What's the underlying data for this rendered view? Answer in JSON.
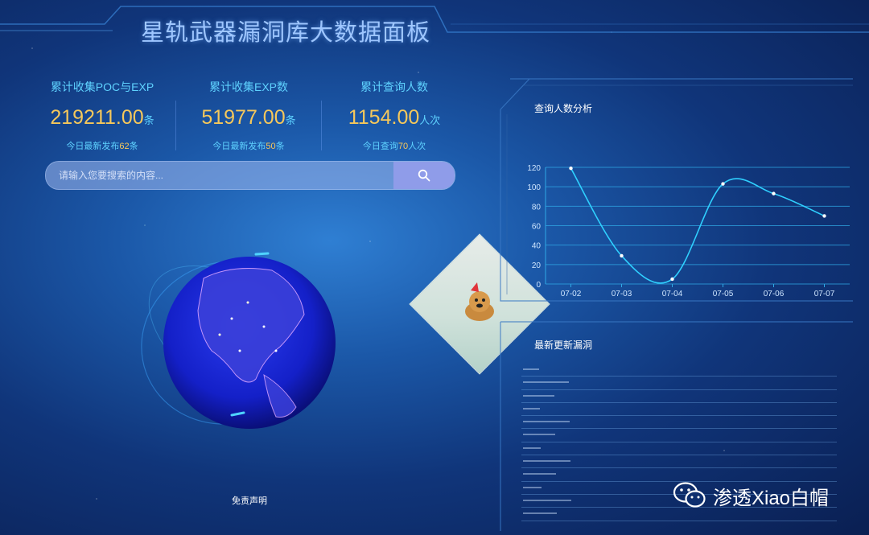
{
  "header": {
    "title": "星轨武器漏洞库大数据面板"
  },
  "stats": [
    {
      "label": "累计收集POC与EXP",
      "value": "219211.00",
      "unit": "条",
      "today_prefix": "今日最新发布",
      "today_num": "62",
      "today_suffix": "条"
    },
    {
      "label": "累计收集EXP数",
      "value": "51977.00",
      "unit": "条",
      "today_prefix": "今日最新发布",
      "today_num": "50",
      "today_suffix": "条"
    },
    {
      "label": "累计查询人数",
      "value": "1154.00",
      "unit": "人次",
      "today_prefix": "今日查询",
      "today_num": "70",
      "today_suffix": "人次"
    }
  ],
  "search": {
    "placeholder": "请输入您要搜索的内容...",
    "icon": "search-icon"
  },
  "footer": {
    "disclaimer": "免责声明"
  },
  "query_panel": {
    "title": "查询人数分析"
  },
  "vuln_panel": {
    "title": "最新更新漏洞"
  },
  "watermark": {
    "text": "渗透Xiao白帽",
    "icon": "wechat-icon"
  },
  "colors": {
    "accent": "#5fd2ff",
    "value": "#f6c85b",
    "line": "#2fd0ff"
  },
  "chart_data": {
    "type": "line",
    "categories": [
      "07-02",
      "07-03",
      "07-04",
      "07-05",
      "07-06",
      "07-07"
    ],
    "values": [
      119,
      29,
      5,
      103,
      93,
      70
    ],
    "ylim": [
      0,
      120
    ],
    "yticks": [
      0,
      20,
      40,
      60,
      80,
      100,
      120
    ],
    "grid": true
  }
}
